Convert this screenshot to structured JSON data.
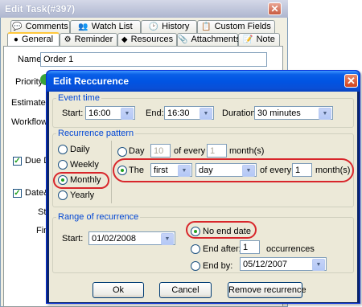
{
  "task_window": {
    "title": "Edit Task(#397)",
    "close_glyph": "✕",
    "tabs_row1": [
      {
        "label": "Comments",
        "icon": "comments-icon"
      },
      {
        "label": "Watch List",
        "icon": "watch-list-icon"
      },
      {
        "label": "History",
        "icon": "history-icon"
      },
      {
        "label": "Custom Fields",
        "icon": "custom-fields-icon"
      }
    ],
    "tabs_row2": [
      {
        "label": "General",
        "icon": "general-icon"
      },
      {
        "label": "Reminder",
        "icon": "reminder-icon"
      },
      {
        "label": "Resources",
        "icon": "resources-icon"
      },
      {
        "label": "Attachments",
        "icon": "attachments-icon"
      },
      {
        "label": "Note",
        "icon": "note-icon"
      }
    ],
    "name_label": "Name:",
    "name_value": "Order 1",
    "priority_label": "Priority:",
    "estimated_label": "Estimated T",
    "workflow_label": "Workflow",
    "due_date_label": "Due Da",
    "date_time_label": "Date&T",
    "st_label": "St",
    "fin_label": "Fin"
  },
  "dialog": {
    "title": "Edit Reccurence",
    "close_glyph": "✕",
    "event_time": {
      "legend": "Event time",
      "start_label": "Start:",
      "start_value": "16:00",
      "end_label": "End:",
      "end_value": "16:30",
      "duration_label": "Duration:",
      "duration_value": "30 minutes"
    },
    "pattern": {
      "legend": "Recurrence pattern",
      "options": [
        "Daily",
        "Weekly",
        "Monthly",
        "Yearly"
      ],
      "selected": "Monthly",
      "day_label": "Day",
      "day_value": "10",
      "of_every_label": "of every",
      "of_every_value": "1",
      "months_label": "month(s)",
      "the_label": "The",
      "ordinal_value": "first",
      "weekday_value": "day",
      "the_of_every_label": "of every",
      "the_every_value": "1",
      "the_months_label": "month(s)"
    },
    "range": {
      "legend": "Range of recurrence",
      "start_label": "Start:",
      "start_value": "01/02/2008",
      "no_end_label": "No end date",
      "end_after_label": "End after:",
      "end_after_value": "1",
      "occurrences_label": "occurrences",
      "end_by_label": "End by:",
      "end_by_value": "05/12/2007"
    },
    "buttons": {
      "ok": "Ok",
      "cancel": "Cancel",
      "remove": "Remove recurrence"
    }
  }
}
